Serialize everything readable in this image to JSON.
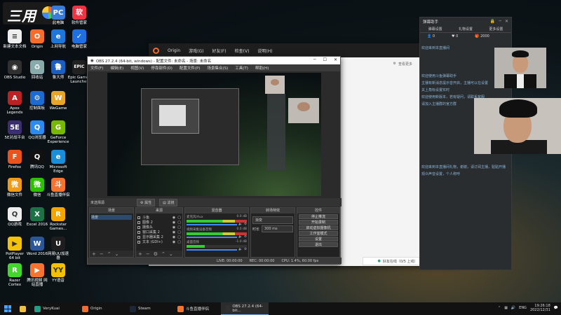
{
  "banner": {
    "logo_text": "三用"
  },
  "desktop_icons": [
    {
      "label": "此电脑",
      "color": "#3a7bd5",
      "glyph": "PC"
    },
    {
      "label": "软件管家",
      "color": "#e34",
      "glyph": "软"
    },
    {
      "label": "新建文本文档",
      "color": "#eee",
      "glyph": "≡"
    },
    {
      "label": "Origin",
      "color": "#f56c2d",
      "glyph": "O"
    },
    {
      "label": "上网导航",
      "color": "#1f75d8",
      "glyph": "e"
    },
    {
      "label": "电脑管家",
      "color": "#1e6fe0",
      "glyph": "✓"
    },
    {
      "label": "OBS Studio",
      "color": "#303030",
      "glyph": "◉"
    },
    {
      "label": "回收站",
      "color": "#8aa",
      "glyph": "♻"
    },
    {
      "label": "鲁大师",
      "color": "#1b5ec2",
      "glyph": "鲁"
    },
    {
      "label": "Epic Games Launcher",
      "color": "#222",
      "glyph": "EPIC"
    },
    {
      "label": "Apex Legends",
      "color": "#b22",
      "glyph": "A"
    },
    {
      "label": "控制面板",
      "color": "#1b6bd0",
      "glyph": "⚙"
    },
    {
      "label": "WeGame",
      "color": "#e7a52a",
      "glyph": "W"
    },
    {
      "label": "5E对战平台",
      "color": "#3b2f6f",
      "glyph": "5E"
    },
    {
      "label": "QQ浏览器",
      "color": "#2a8bf2",
      "glyph": "Q"
    },
    {
      "label": "GeForce Experience",
      "color": "#76b900",
      "glyph": "G"
    },
    {
      "label": "Firefox",
      "color": "#e8541c",
      "glyph": "F"
    },
    {
      "label": "腾讯QQ",
      "color": "#111",
      "glyph": "Q"
    },
    {
      "label": "Microsoft Edge",
      "color": "#1a8ed8",
      "glyph": "e"
    },
    {
      "label": "微信文件",
      "color": "#f09a1a",
      "glyph": "微"
    },
    {
      "label": "微信",
      "color": "#2dc100",
      "glyph": "微"
    },
    {
      "label": "斗鱼直播伴侣",
      "color": "#f6742f",
      "glyph": "斗"
    },
    {
      "label": "QQ游戏",
      "color": "#eee",
      "glyph": "Q"
    },
    {
      "label": "Excel 2016",
      "color": "#1e7145",
      "glyph": "X"
    },
    {
      "label": "Rockstar Games...",
      "color": "#f5a500",
      "glyph": "R"
    },
    {
      "label": "PotPlayer 64 bit",
      "color": "#f4c20d",
      "glyph": "▶"
    },
    {
      "label": "Word 2016",
      "color": "#2b5797",
      "glyph": "W"
    },
    {
      "label": "网易UU加速器",
      "color": "#1e1e1e",
      "glyph": "U"
    },
    {
      "label": "Razer Cortex",
      "color": "#44d62c",
      "glyph": "R"
    },
    {
      "label": "腾讯视频 网站直播",
      "color": "#f6742f",
      "glyph": "▶"
    },
    {
      "label": "YY语音",
      "color": "#f5c000",
      "glyph": "YY"
    },
    {
      "label": "VeryKuai VK加速器",
      "color": "#1ea086",
      "glyph": "VK"
    }
  ],
  "origin": {
    "app_name": "Origin",
    "menu": [
      "游戏(G)",
      "好友(F)",
      "检查(V)",
      "说明(H)"
    ],
    "side_link": "查看更多",
    "send_button": "好友在线（0/5 上线）"
  },
  "obs": {
    "title": "OBS 27.2.4 (64-bit, windows) - 配置文件: 未命名 - 场景: 未命名",
    "menu": [
      "文件(F)",
      "编辑(E)",
      "视图(V)",
      "停靠部件(D)",
      "配置文件(P)",
      "场景集合(S)",
      "工具(T)",
      "帮助(H)"
    ],
    "source_bar_label": "未选择源",
    "props_button": "属性",
    "filters_button": "滤镜",
    "docks": {
      "scenes": {
        "title": "场景",
        "items": [
          "场景"
        ]
      },
      "sources": {
        "title": "来源",
        "items": [
          "斗鱼",
          "图像 2",
          "摄像头",
          "窗口采集 2",
          "显示器采集 2",
          "文本 (GDI+)"
        ]
      },
      "mixer": {
        "title": "混音器",
        "items": [
          {
            "name": "麦克风/Aux",
            "level": "0.0 dB"
          },
          {
            "name": "视频采集设备音频",
            "level": "0.0 dB"
          },
          {
            "name": "桌面音频",
            "level": "-1.0 dB"
          }
        ]
      },
      "transitions": {
        "title": "转场特效",
        "type": "渐变",
        "duration_label": "时长",
        "duration": "300 ms"
      },
      "controls": {
        "title": "控件",
        "buttons": [
          "停止推流",
          "开始录制",
          "启动虚拟摄像机",
          "工作室模式",
          "设置",
          "退出"
        ]
      }
    },
    "status": {
      "live": "LIVE: 00:00:00",
      "rec": "REC: 00:00:00",
      "cpu": "CPU: 1.4%, 60.00 fps"
    }
  },
  "chat": {
    "title": "弹幕助手",
    "tabs": [
      "弹幕设置",
      "礼物设置",
      "更多设置"
    ],
    "stats": [
      {
        "icon": "user-icon",
        "value": "0"
      },
      {
        "icon": "heart-icon",
        "value": "0"
      },
      {
        "icon": "gift-icon",
        "value": "2000"
      }
    ],
    "lines": [
      "欢迎来到本直播间",
      "",
      "",
      "",
      "欢迎使用斗鱼弹幕助手",
      "主播有新消息提示音开启，主播可以在设置",
      "关上角标设置实时",
      "欢迎使用新版本，若有疑问，请联系客服",
      "请加入主播群的官方群",
      "",
      "",
      "",
      "",
      "",
      "",
      "",
      "",
      "欢迎来到本直播间礼物，谢谢，请订阅主播，贴贴开播",
      "观众声音设置，个人称呼"
    ]
  },
  "taskbar": {
    "items": [
      {
        "label": "VeryKuai",
        "color": "#1ea086",
        "active": false
      },
      {
        "label": "Origin",
        "color": "#f56c2d",
        "active": false
      },
      {
        "label": "Steam",
        "color": "#1b2838",
        "active": false
      },
      {
        "label": "斗鱼直播伴侣",
        "color": "#f6742f",
        "active": false
      },
      {
        "label": "OBS 27.2.4 (64-bit...",
        "color": "#303030",
        "active": true
      }
    ],
    "lang": "ENG",
    "time": "19:26:18",
    "date": "2022/12/31"
  }
}
